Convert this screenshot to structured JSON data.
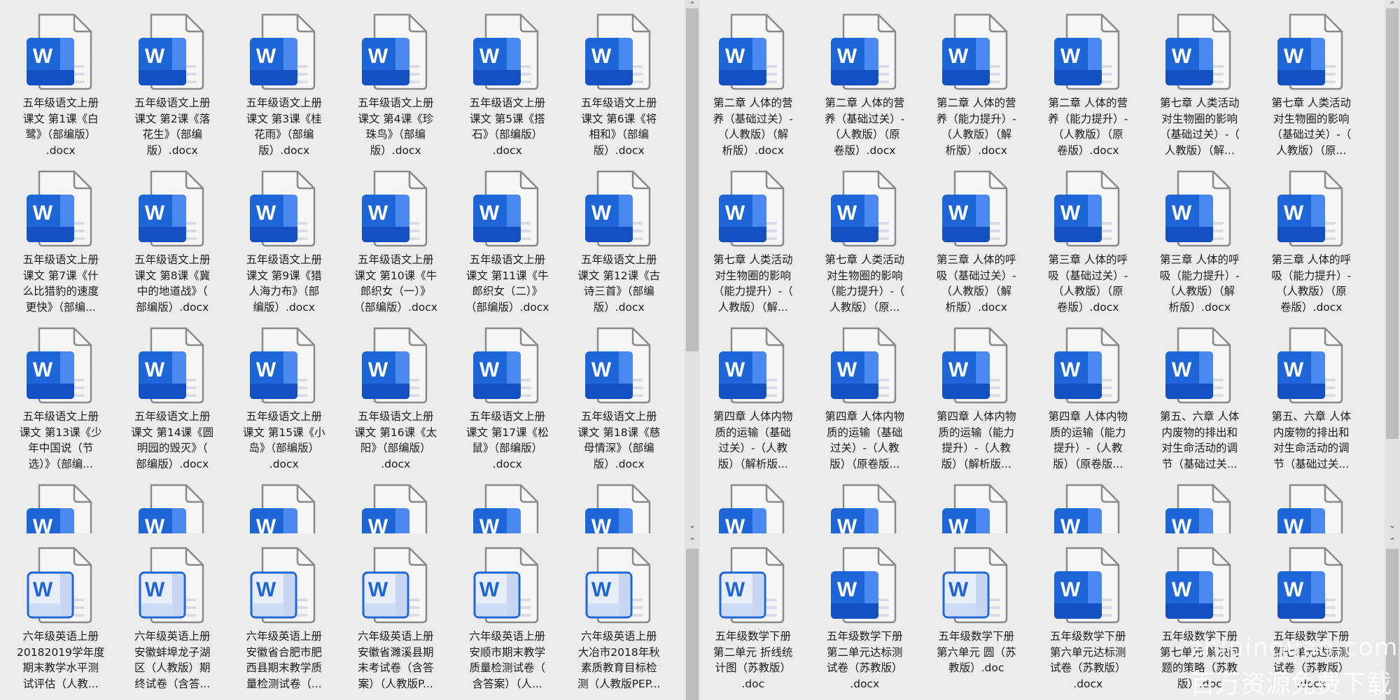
{
  "colors": {
    "word_blue": "#1e66d8",
    "word_blue_dark": "#1450c2",
    "word_blue_light": "#4a8af0",
    "page_border": "#8a8a8a",
    "background": "#ececec"
  },
  "panes": [
    {
      "id": "top-left",
      "items": [
        {
          "label": "五年级语文上册\n课文 第1课《白\n鹭》（部编版）\n.docx",
          "style": "solid"
        },
        {
          "label": "五年级语文上册\n课文 第2课《落\n花生》（部编\n版）.docx",
          "style": "solid"
        },
        {
          "label": "五年级语文上册\n课文 第3课《桂\n花雨》（部编\n版）.docx",
          "style": "solid"
        },
        {
          "label": "五年级语文上册\n课文 第4课《珍\n珠鸟》（部编\n版）.docx",
          "style": "solid"
        },
        {
          "label": "五年级语文上册\n课文 第5课《搭\n石》（部编版）\n.docx",
          "style": "solid"
        },
        {
          "label": "五年级语文上册\n课文 第6课《将\n相和》（部编\n版）.docx",
          "style": "solid"
        },
        {
          "label": "五年级语文上册\n课文 第7课《什\n么比猎豹的速度\n更快》（部编...",
          "style": "solid"
        },
        {
          "label": "五年级语文上册\n课文 第8课《冀\n中的地道战》（\n部编版）.docx",
          "style": "solid"
        },
        {
          "label": "五年级语文上册\n课文 第9课《猎\n人海力布》（部\n编版）.docx",
          "style": "solid"
        },
        {
          "label": "五年级语文上册\n课文 第10课《牛\n郎织女（一）》\n（部编版）.docx",
          "style": "solid"
        },
        {
          "label": "五年级语文上册\n课文 第11课《牛\n郎织女（二）》\n（部编版）.docx",
          "style": "solid"
        },
        {
          "label": "五年级语文上册\n课文 第12课《古\n诗三首》（部编\n版）.docx",
          "style": "solid"
        },
        {
          "label": "五年级语文上册\n课文 第13课《少\n年中国说（节\n选）》（部编...",
          "style": "solid"
        },
        {
          "label": "五年级语文上册\n课文 第14课《圆\n明园的毁灭》（\n部编版）.docx",
          "style": "solid"
        },
        {
          "label": "五年级语文上册\n课文 第15课《小\n岛》（部编版）\n.docx",
          "style": "solid"
        },
        {
          "label": "五年级语文上册\n课文 第16课《太\n阳》（部编版）\n.docx",
          "style": "solid"
        },
        {
          "label": "五年级语文上册\n课文 第17课《松\n鼠》（部编版）\n.docx",
          "style": "solid"
        },
        {
          "label": "五年级语文上册\n课文 第18课《慈\n母情深》（部编\n版）.docx",
          "style": "solid"
        },
        {
          "label": "",
          "style": "solid"
        },
        {
          "label": "",
          "style": "solid"
        },
        {
          "label": "",
          "style": "solid"
        },
        {
          "label": "",
          "style": "solid"
        },
        {
          "label": "",
          "style": "solid"
        },
        {
          "label": "",
          "style": "solid"
        }
      ]
    },
    {
      "id": "top-right",
      "items": [
        {
          "label": "第二章 人体的营\n养（基础过关）-\n（人教版）（解\n析版）.docx",
          "style": "solid"
        },
        {
          "label": "第二章 人体的营\n养（基础过关）-\n（人教版）（原\n卷版）.docx",
          "style": "solid"
        },
        {
          "label": "第二章 人体的营\n养（能力提升）-\n（人教版）（解\n析版）.docx",
          "style": "solid"
        },
        {
          "label": "第二章 人体的营\n养（能力提升）-\n（人教版）（原\n卷版）.docx",
          "style": "solid"
        },
        {
          "label": "第七章 人类活动\n对生物圈的影响\n（基础过关）-（\n人教版）（解...",
          "style": "solid"
        },
        {
          "label": "第七章 人类活动\n对生物圈的影响\n（基础过关）-（\n人教版）（原...",
          "style": "solid"
        },
        {
          "label": "第七章 人类活动\n对生物圈的影响\n（能力提升）-（\n人教版）（解...",
          "style": "solid"
        },
        {
          "label": "第七章 人类活动\n对生物圈的影响\n（能力提升）-（\n人教版）（原...",
          "style": "solid"
        },
        {
          "label": "第三章 人体的呼\n吸（基础过关）-\n（人教版）（解\n析版）.docx",
          "style": "solid"
        },
        {
          "label": "第三章 人体的呼\n吸（基础过关）-\n（人教版）（原\n卷版）.docx",
          "style": "solid"
        },
        {
          "label": "第三章 人体的呼\n吸（能力提升）-\n（人教版）（解\n析版）.docx",
          "style": "solid"
        },
        {
          "label": "第三章 人体的呼\n吸（能力提升）-\n（人教版）（原\n卷版）.docx",
          "style": "solid"
        },
        {
          "label": "第四章 人体内物\n质的运输（基础\n过关）-（人教\n版）（解析版...",
          "style": "solid"
        },
        {
          "label": "第四章 人体内物\n质的运输（基础\n过关）-（人教\n版）（原卷版...",
          "style": "solid"
        },
        {
          "label": "第四章 人体内物\n质的运输（能力\n提升）-（人教\n版）（解析版...",
          "style": "solid"
        },
        {
          "label": "第四章 人体内物\n质的运输（能力\n提升）-（人教\n版）（原卷版...",
          "style": "solid"
        },
        {
          "label": "第五、六章 人体\n内废物的排出和\n对生命活动的调\n节（基础过关...",
          "style": "solid"
        },
        {
          "label": "第五、六章 人体\n内废物的排出和\n对生命活动的调\n节（基础过关...",
          "style": "solid"
        },
        {
          "label": "",
          "style": "solid"
        },
        {
          "label": "",
          "style": "solid"
        },
        {
          "label": "",
          "style": "solid"
        },
        {
          "label": "",
          "style": "solid"
        },
        {
          "label": "",
          "style": "solid"
        },
        {
          "label": "",
          "style": "solid"
        }
      ]
    },
    {
      "id": "bottom-left",
      "items": [
        {
          "label": "六年级英语上册\n20182019学年度\n期末教学水平测\n试评估（人教...",
          "style": "outline"
        },
        {
          "label": "六年级英语上册\n安徽蚌埠龙子湖\n区（人教版）期\n终试卷（含答...",
          "style": "outline"
        },
        {
          "label": "六年级英语上册\n安徽省合肥市肥\n西县期末教学质\n量检测试卷（...",
          "style": "outline"
        },
        {
          "label": "六年级英语上册\n安徽省濉溪县期\n末考试卷（含答\n案）（人教版P...",
          "style": "outline"
        },
        {
          "label": "六年级英语上册\n安顺市期末教学\n质量检测试卷（\n含答案）（人...",
          "style": "outline"
        },
        {
          "label": "六年级英语上册\n大冶市2018年秋\n素质教育目标检\n测（人教版PEP...",
          "style": "outline"
        }
      ]
    },
    {
      "id": "bottom-right",
      "items": [
        {
          "label": "五年级数学下册\n第二单元 折线统\n计图（苏教版）\n.doc",
          "style": "outline"
        },
        {
          "label": "五年级数学下册\n第二单元达标测\n试卷（苏教版）\n.docx",
          "style": "solid"
        },
        {
          "label": "五年级数学下册\n第六单元 圆（苏\n教版）.doc",
          "style": "outline"
        },
        {
          "label": "五年级数学下册\n第六单元达标测\n试卷（苏教版）\n.docx",
          "style": "solid"
        },
        {
          "label": "五年级数学下册\n第七单元 解决问\n题的策略（苏教\n版）.doc",
          "style": "solid"
        },
        {
          "label": "五年级数学下册\n第七单元达标测\n试卷（苏教版）\n.docx",
          "style": "solid"
        }
      ]
    }
  ],
  "watermark": {
    "line1": "zhipinquan.com",
    "line2": "百万资源免费下载"
  }
}
